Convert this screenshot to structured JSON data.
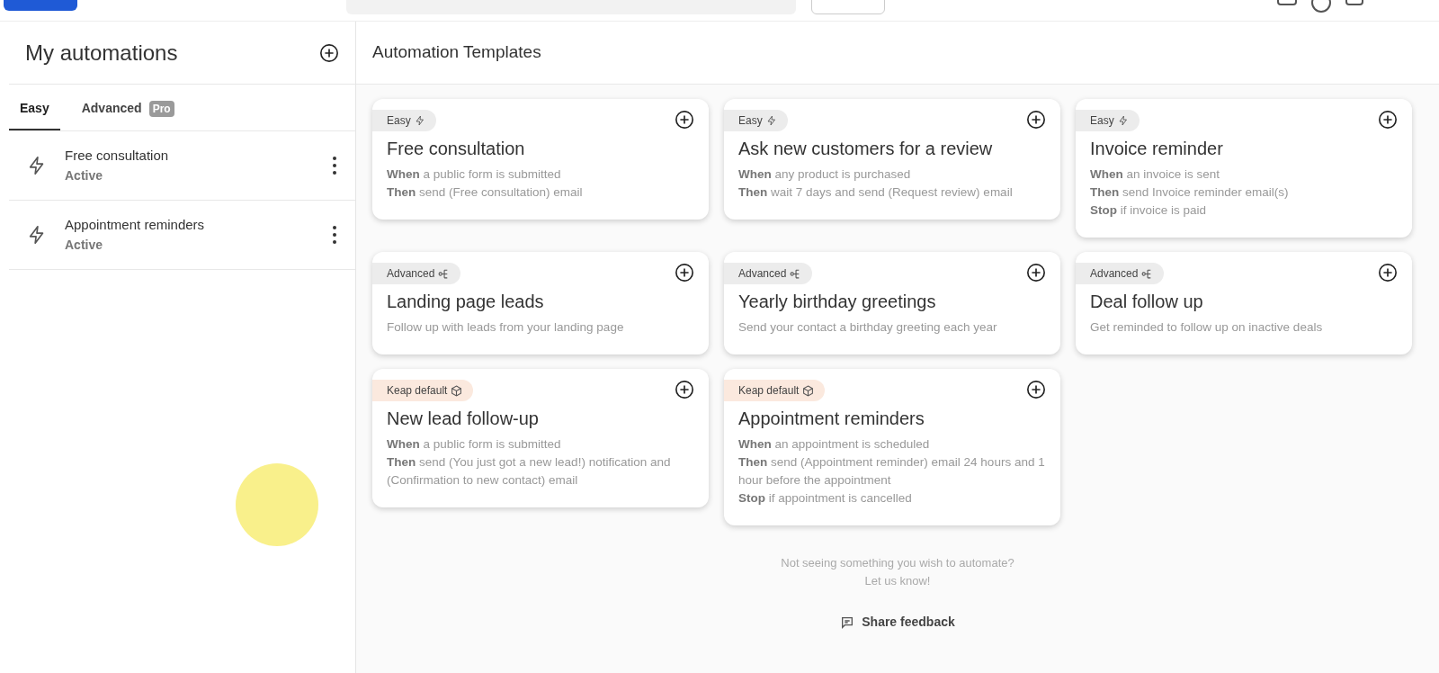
{
  "sidebar": {
    "title": "My automations",
    "tabs": [
      {
        "label": "Easy",
        "selected": true
      },
      {
        "label": "Advanced",
        "selected": false,
        "badge": "Pro"
      }
    ],
    "items": [
      {
        "name": "Free consultation",
        "status": "Active"
      },
      {
        "name": "Appointment reminders",
        "status": "Active"
      }
    ]
  },
  "main": {
    "title": "Automation Templates",
    "templates": [
      {
        "kind": "easy",
        "badge": "Easy",
        "title": "Free consultation",
        "lines": [
          "**When** a public form is submitted",
          "**Then** send (Free consultation) email"
        ]
      },
      {
        "kind": "easy",
        "badge": "Easy",
        "title": "Ask new customers for a review",
        "lines": [
          "**When** any product is purchased",
          "**Then** wait 7 days and send (Request review) email"
        ]
      },
      {
        "kind": "easy",
        "badge": "Easy",
        "title": "Invoice reminder",
        "lines": [
          "**When** an invoice is sent",
          "**Then** send Invoice reminder email(s)",
          "**Stop** if invoice is paid"
        ]
      },
      {
        "kind": "advanced",
        "badge": "Advanced",
        "title": "Landing page leads",
        "lines": [
          "Follow up with leads from your landing page"
        ]
      },
      {
        "kind": "advanced",
        "badge": "Advanced",
        "title": "Yearly birthday greetings",
        "lines": [
          "Send your contact a birthday greeting each year"
        ]
      },
      {
        "kind": "advanced",
        "badge": "Advanced",
        "title": "Deal follow up",
        "lines": [
          "Get reminded to follow up on inactive deals"
        ]
      },
      {
        "kind": "default",
        "badge": "Keap default",
        "title": "New lead follow-up",
        "lines": [
          "**When** a public form is submitted",
          "**Then** send (You just got a new lead!) notification and (Confirmation to new contact) email"
        ]
      },
      {
        "kind": "default",
        "badge": "Keap default",
        "title": "Appointment reminders",
        "lines": [
          "**When** an appointment is scheduled",
          "**Then** send (Appointment reminder) email 24 hours and 1 hour before the appointment",
          "**Stop** if appointment is cancelled"
        ]
      }
    ],
    "footer": {
      "text": "Not seeing something you wish to automate?",
      "link": "Let us know!",
      "button": "Share feedback"
    }
  }
}
